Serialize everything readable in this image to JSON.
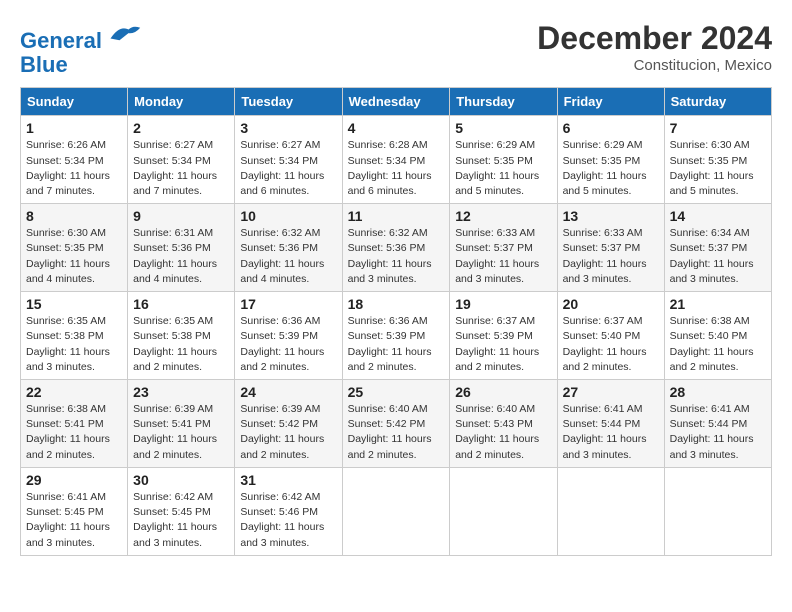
{
  "header": {
    "logo_line1": "General",
    "logo_line2": "Blue",
    "month": "December 2024",
    "location": "Constitucion, Mexico"
  },
  "days_of_week": [
    "Sunday",
    "Monday",
    "Tuesday",
    "Wednesday",
    "Thursday",
    "Friday",
    "Saturday"
  ],
  "weeks": [
    [
      {
        "day": "1",
        "sunrise": "6:26 AM",
        "sunset": "5:34 PM",
        "daylight": "11 hours and 7 minutes."
      },
      {
        "day": "2",
        "sunrise": "6:27 AM",
        "sunset": "5:34 PM",
        "daylight": "11 hours and 7 minutes."
      },
      {
        "day": "3",
        "sunrise": "6:27 AM",
        "sunset": "5:34 PM",
        "daylight": "11 hours and 6 minutes."
      },
      {
        "day": "4",
        "sunrise": "6:28 AM",
        "sunset": "5:34 PM",
        "daylight": "11 hours and 6 minutes."
      },
      {
        "day": "5",
        "sunrise": "6:29 AM",
        "sunset": "5:35 PM",
        "daylight": "11 hours and 5 minutes."
      },
      {
        "day": "6",
        "sunrise": "6:29 AM",
        "sunset": "5:35 PM",
        "daylight": "11 hours and 5 minutes."
      },
      {
        "day": "7",
        "sunrise": "6:30 AM",
        "sunset": "5:35 PM",
        "daylight": "11 hours and 5 minutes."
      }
    ],
    [
      {
        "day": "8",
        "sunrise": "6:30 AM",
        "sunset": "5:35 PM",
        "daylight": "11 hours and 4 minutes."
      },
      {
        "day": "9",
        "sunrise": "6:31 AM",
        "sunset": "5:36 PM",
        "daylight": "11 hours and 4 minutes."
      },
      {
        "day": "10",
        "sunrise": "6:32 AM",
        "sunset": "5:36 PM",
        "daylight": "11 hours and 4 minutes."
      },
      {
        "day": "11",
        "sunrise": "6:32 AM",
        "sunset": "5:36 PM",
        "daylight": "11 hours and 3 minutes."
      },
      {
        "day": "12",
        "sunrise": "6:33 AM",
        "sunset": "5:37 PM",
        "daylight": "11 hours and 3 minutes."
      },
      {
        "day": "13",
        "sunrise": "6:33 AM",
        "sunset": "5:37 PM",
        "daylight": "11 hours and 3 minutes."
      },
      {
        "day": "14",
        "sunrise": "6:34 AM",
        "sunset": "5:37 PM",
        "daylight": "11 hours and 3 minutes."
      }
    ],
    [
      {
        "day": "15",
        "sunrise": "6:35 AM",
        "sunset": "5:38 PM",
        "daylight": "11 hours and 3 minutes."
      },
      {
        "day": "16",
        "sunrise": "6:35 AM",
        "sunset": "5:38 PM",
        "daylight": "11 hours and 2 minutes."
      },
      {
        "day": "17",
        "sunrise": "6:36 AM",
        "sunset": "5:39 PM",
        "daylight": "11 hours and 2 minutes."
      },
      {
        "day": "18",
        "sunrise": "6:36 AM",
        "sunset": "5:39 PM",
        "daylight": "11 hours and 2 minutes."
      },
      {
        "day": "19",
        "sunrise": "6:37 AM",
        "sunset": "5:39 PM",
        "daylight": "11 hours and 2 minutes."
      },
      {
        "day": "20",
        "sunrise": "6:37 AM",
        "sunset": "5:40 PM",
        "daylight": "11 hours and 2 minutes."
      },
      {
        "day": "21",
        "sunrise": "6:38 AM",
        "sunset": "5:40 PM",
        "daylight": "11 hours and 2 minutes."
      }
    ],
    [
      {
        "day": "22",
        "sunrise": "6:38 AM",
        "sunset": "5:41 PM",
        "daylight": "11 hours and 2 minutes."
      },
      {
        "day": "23",
        "sunrise": "6:39 AM",
        "sunset": "5:41 PM",
        "daylight": "11 hours and 2 minutes."
      },
      {
        "day": "24",
        "sunrise": "6:39 AM",
        "sunset": "5:42 PM",
        "daylight": "11 hours and 2 minutes."
      },
      {
        "day": "25",
        "sunrise": "6:40 AM",
        "sunset": "5:42 PM",
        "daylight": "11 hours and 2 minutes."
      },
      {
        "day": "26",
        "sunrise": "6:40 AM",
        "sunset": "5:43 PM",
        "daylight": "11 hours and 2 minutes."
      },
      {
        "day": "27",
        "sunrise": "6:41 AM",
        "sunset": "5:44 PM",
        "daylight": "11 hours and 3 minutes."
      },
      {
        "day": "28",
        "sunrise": "6:41 AM",
        "sunset": "5:44 PM",
        "daylight": "11 hours and 3 minutes."
      }
    ],
    [
      {
        "day": "29",
        "sunrise": "6:41 AM",
        "sunset": "5:45 PM",
        "daylight": "11 hours and 3 minutes."
      },
      {
        "day": "30",
        "sunrise": "6:42 AM",
        "sunset": "5:45 PM",
        "daylight": "11 hours and 3 minutes."
      },
      {
        "day": "31",
        "sunrise": "6:42 AM",
        "sunset": "5:46 PM",
        "daylight": "11 hours and 3 minutes."
      },
      null,
      null,
      null,
      null
    ]
  ]
}
